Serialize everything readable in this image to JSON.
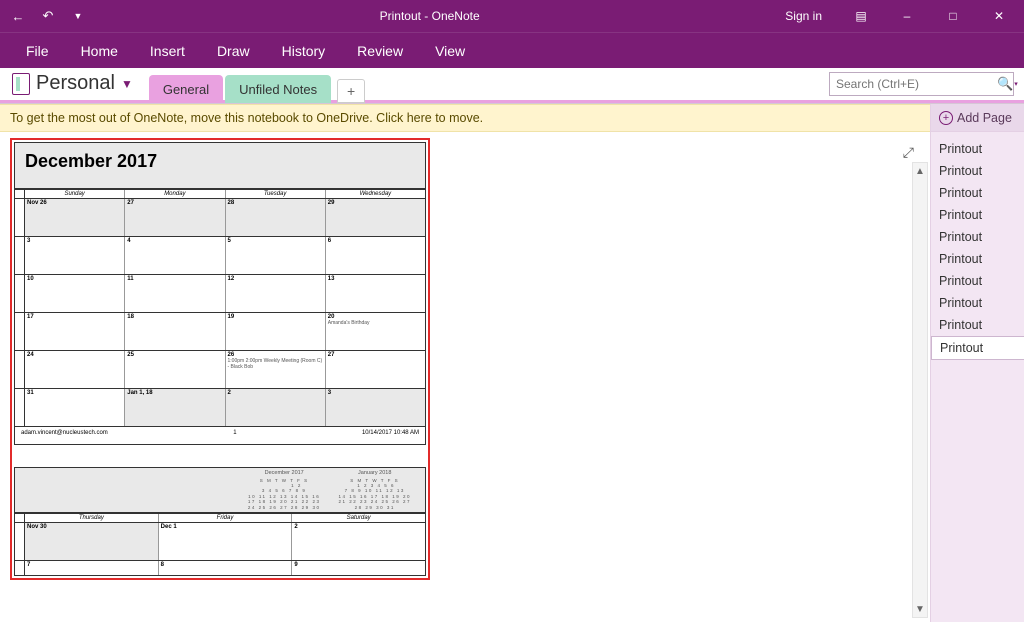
{
  "titlebar": {
    "title": "Printout  -  OneNote",
    "signin": "Sign in"
  },
  "menu": [
    "File",
    "Home",
    "Insert",
    "Draw",
    "History",
    "Review",
    "View"
  ],
  "notebook": {
    "name": "Personal"
  },
  "section_tabs": {
    "general": "General",
    "unfiled": "Unfiled Notes"
  },
  "search": {
    "placeholder": "Search (Ctrl+E)"
  },
  "infobar": "To get the most out of OneNote, move this notebook to OneDrive. Click here to move.",
  "sidebar": {
    "add_page": "Add Page",
    "pages": [
      "Printout",
      "Printout",
      "Printout",
      "Printout",
      "Printout",
      "Printout",
      "Printout",
      "Printout",
      "Printout",
      "Printout"
    ],
    "active_index": 9
  },
  "calendar": {
    "title": "December 2017",
    "day_headers": [
      "Sunday",
      "Monday",
      "Tuesday",
      "Wednesday"
    ],
    "rows": [
      {
        "cells": [
          {
            "d": "Nov 26",
            "shaded": true
          },
          {
            "d": "27",
            "shaded": true
          },
          {
            "d": "28",
            "shaded": true
          },
          {
            "d": "29",
            "shaded": true
          }
        ]
      },
      {
        "cells": [
          {
            "d": "3"
          },
          {
            "d": "4"
          },
          {
            "d": "5"
          },
          {
            "d": "6"
          }
        ]
      },
      {
        "cells": [
          {
            "d": "10"
          },
          {
            "d": "11"
          },
          {
            "d": "12"
          },
          {
            "d": "13"
          }
        ]
      },
      {
        "cells": [
          {
            "d": "17"
          },
          {
            "d": "18"
          },
          {
            "d": "19"
          },
          {
            "d": "20",
            "event": "Amanda's Birthday"
          }
        ]
      },
      {
        "cells": [
          {
            "d": "24"
          },
          {
            "d": "25"
          },
          {
            "d": "26",
            "event": "1:00pm 2:00pm Weekly Meeting (Room C) - Black Bob"
          },
          {
            "d": "27"
          }
        ]
      },
      {
        "cells": [
          {
            "d": "31"
          },
          {
            "d": "Jan 1, 18",
            "shaded": true
          },
          {
            "d": "2",
            "shaded": true
          },
          {
            "d": "3",
            "shaded": true
          }
        ]
      }
    ],
    "footer_left": "adam.vincent@nucleustech.com",
    "footer_center": "1",
    "footer_right": "10/14/2017 10:48 AM"
  },
  "page2": {
    "minical_left_title": "December 2017",
    "minical_right_title": "January 2018",
    "day_headers": [
      "Thursday",
      "Friday",
      "Saturday"
    ],
    "row1": [
      "Nov 30",
      "Dec 1",
      "2"
    ],
    "row2": [
      "7",
      "8",
      "9"
    ]
  }
}
